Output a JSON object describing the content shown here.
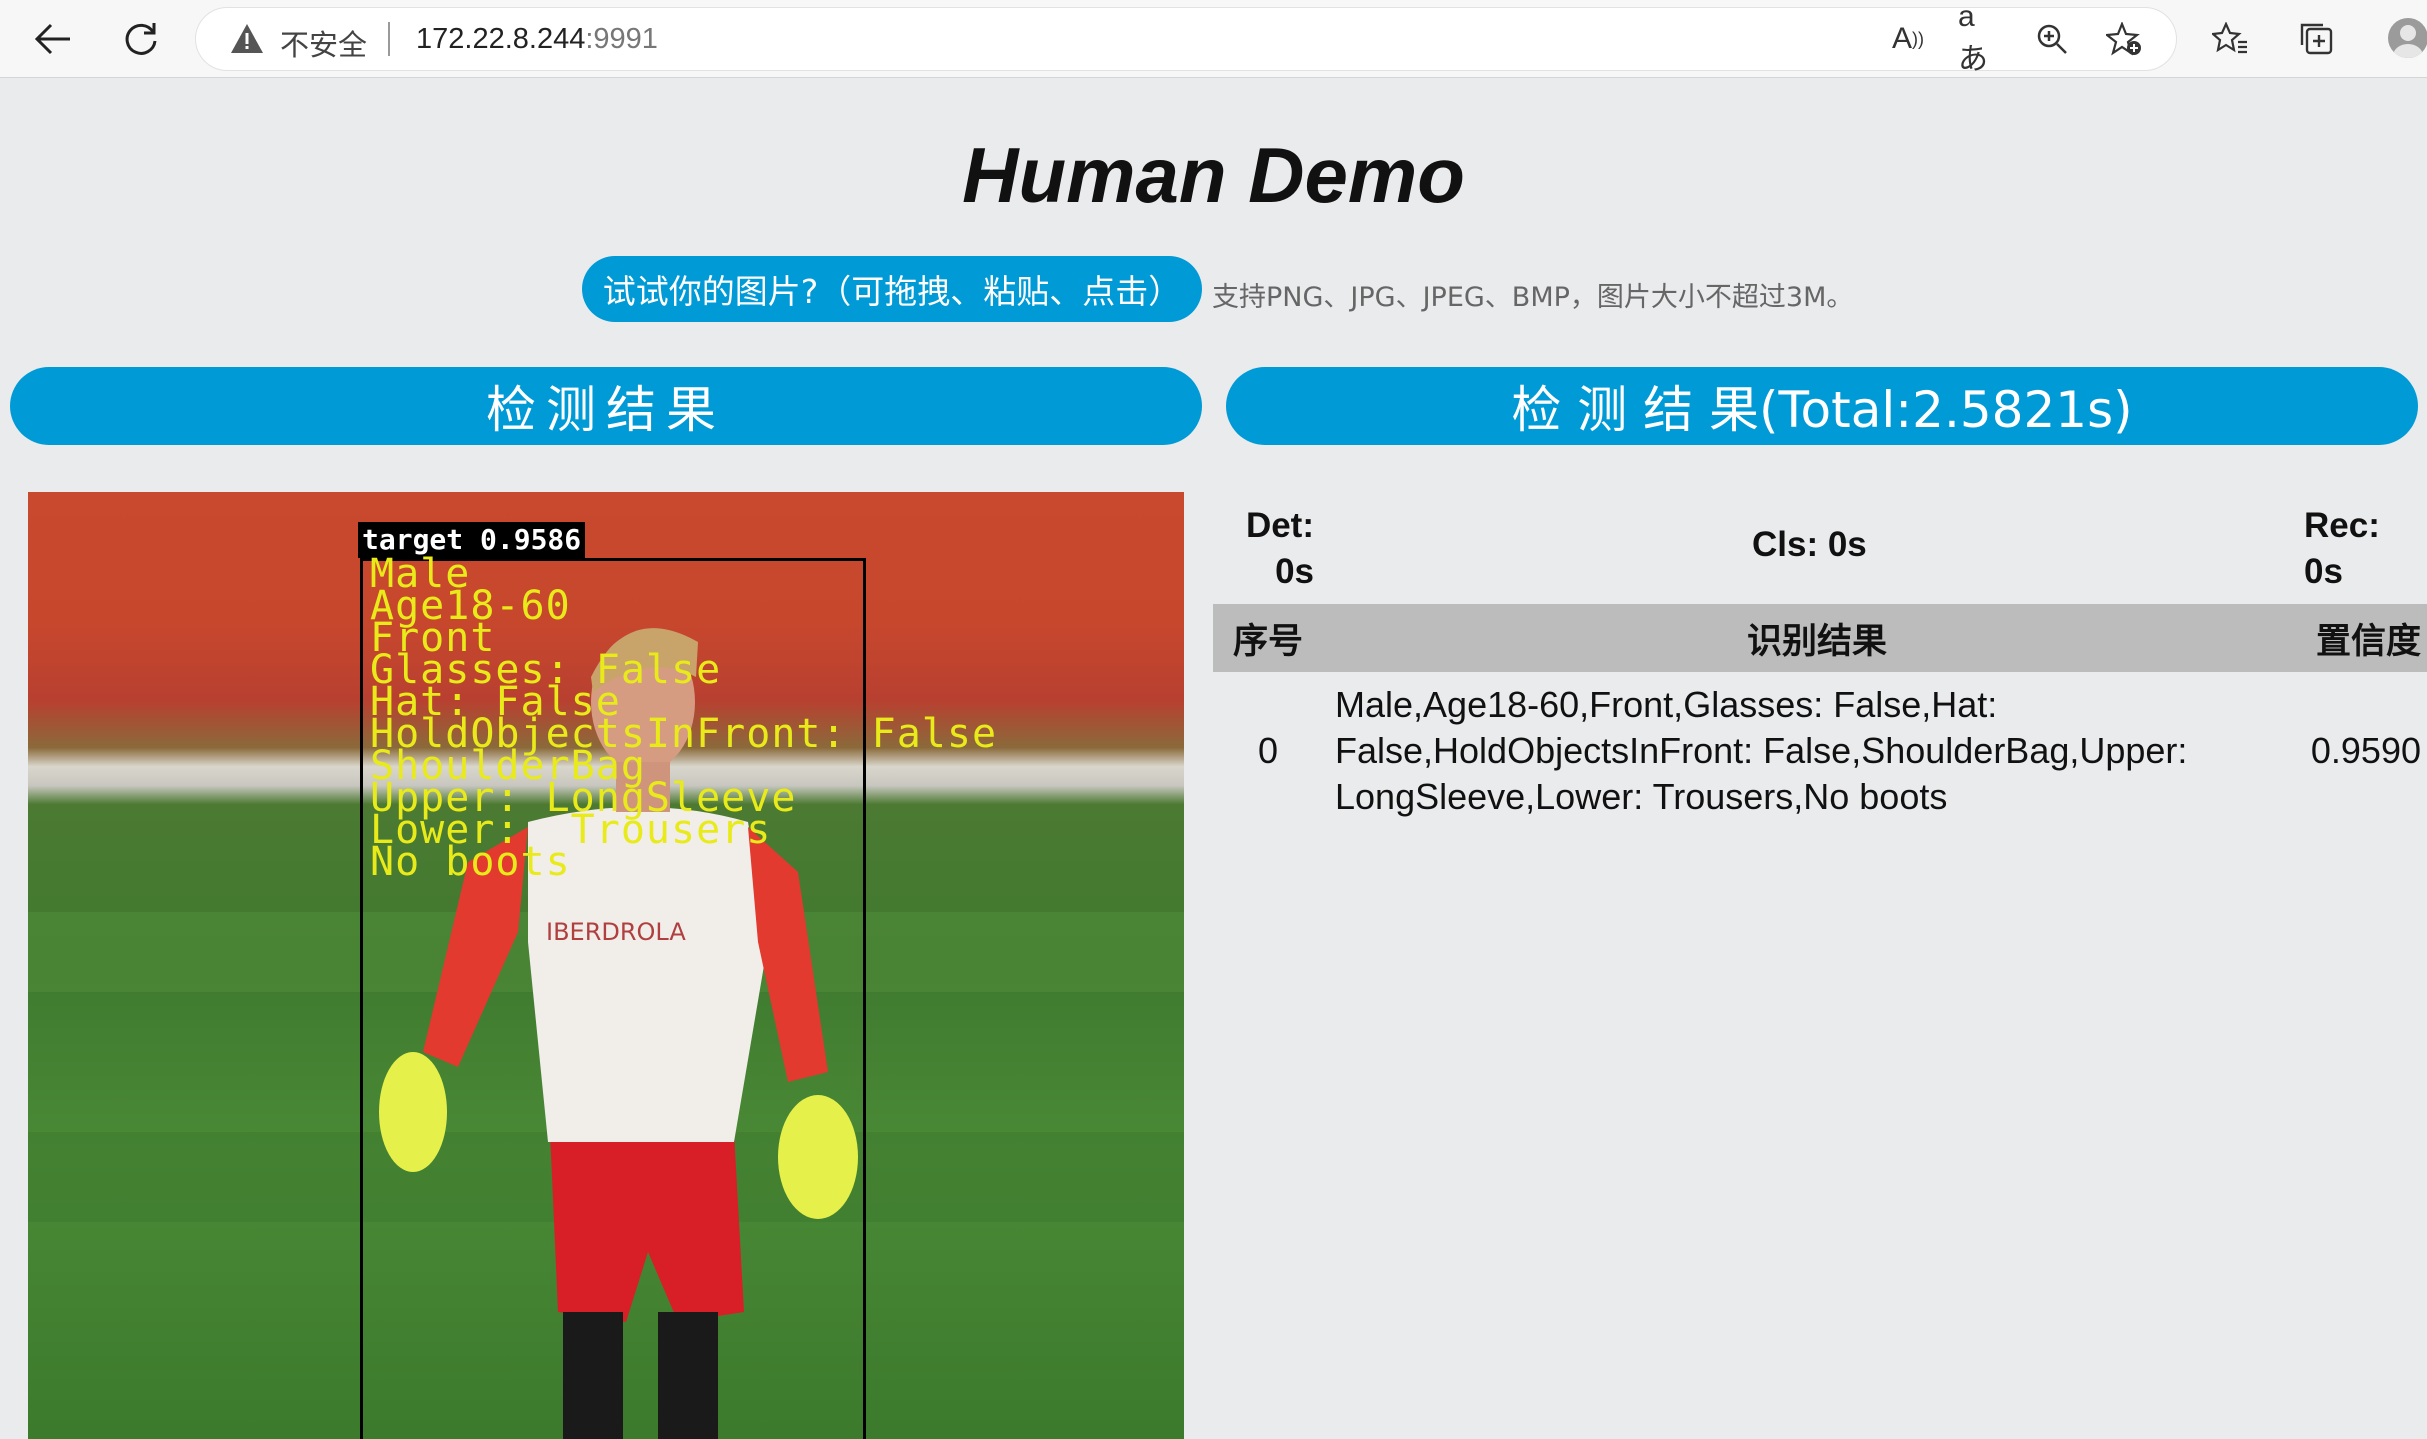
{
  "browser": {
    "security_label": "不安全",
    "url_host": "172.22.8.244",
    "url_port": ":9991"
  },
  "page": {
    "title": "Human Demo",
    "upload_button": "试试你的图片?（可拖拽、粘贴、点击）",
    "upload_hint": "支持PNG、JPG、JPEG、BMP，图片大小不超过3M。",
    "left_header": "检测结果",
    "right_header": "检 测 结 果(Total:2.5821s)"
  },
  "image": {
    "box_label": "target 0.9586",
    "attributes": [
      "Male",
      "Age18-60",
      "Front",
      "Glasses: False",
      "Hat: False",
      "HoldObjectsInFront: False",
      "ShoulderBag",
      "Upper: LongSleeve",
      "Lower:  Trousers",
      "No boots"
    ],
    "shirt_text": "IBERDROLA"
  },
  "timing": {
    "det_label": "Det:",
    "det_value": "0s",
    "cls": "Cls: 0s",
    "rec_label": "Rec:",
    "rec_value": "0s"
  },
  "table": {
    "headers": {
      "index": "序号",
      "result": "识别结果",
      "confidence": "置信度"
    },
    "rows": [
      {
        "index": "0",
        "result": "Male,Age18-60,Front,Glasses: False,Hat: False,HoldObjectsInFront: False,ShoulderBag,Upper: LongSleeve,Lower: Trousers,No boots",
        "confidence": "0.9590"
      }
    ]
  }
}
